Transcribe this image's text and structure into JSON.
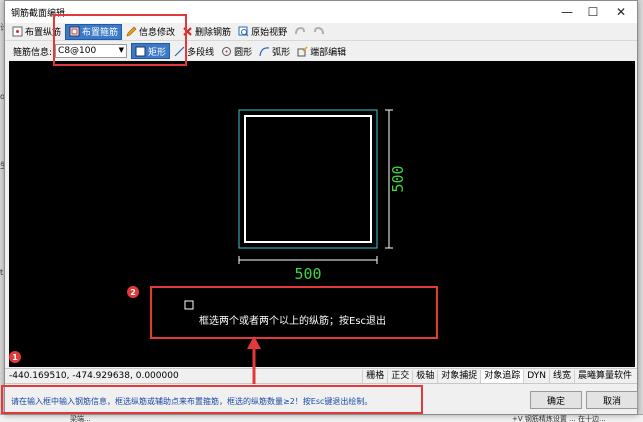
{
  "window": {
    "title": "钢筋截面编辑",
    "minimize": "—",
    "maximize": "☐",
    "close": "✕"
  },
  "toolbar1": {
    "items": [
      {
        "label": "布置纵筋",
        "icon": "longitudinal-rebar-icon"
      },
      {
        "label": "布置箍筋",
        "icon": "stirrup-icon",
        "active": true
      },
      {
        "label": "信息修改",
        "icon": "edit-info-icon"
      },
      {
        "label": "删除钢筋",
        "icon": "delete-icon"
      },
      {
        "label": "原始视野",
        "icon": "original-view-icon"
      }
    ]
  },
  "toolbar2": {
    "stirrup_label": "箍筋信息:",
    "stirrup_value": "C8@100",
    "shapes": [
      {
        "label": "矩形",
        "icon": "rectangle-icon",
        "active": true
      },
      {
        "label": "多段线",
        "icon": "polyline-icon"
      },
      {
        "label": "圆形",
        "icon": "circle-icon"
      },
      {
        "label": "弧形",
        "icon": "arc-icon"
      },
      {
        "label": "端部编辑",
        "icon": "end-edit-icon"
      }
    ]
  },
  "canvas": {
    "dim_width": "500",
    "dim_height": "500",
    "prompt": "框选两个或者两个以上的纵筋；按Esc退出"
  },
  "statusbar": {
    "coords": "-440.169510,  -474.929638,  0.000000",
    "toggles": [
      "栅格",
      "正交",
      "极轴",
      "对象捕捉",
      "对象追踪",
      "DYN",
      "线宽",
      "晨曦算量软件"
    ]
  },
  "cmdbar": {
    "text": "请在输入框中输入钢筋信息，框选纵筋或辅助点来布置箍筋，框选的纵筋数量≥2！按Esc键退出绘制。",
    "ok": "确定",
    "cancel": "取消"
  },
  "annotations": {
    "badge1": "1",
    "badge2": "2"
  },
  "background": {
    "left_chars": [
      "计",
      "o",
      "生",
      "t"
    ],
    "bottom_left": "梁端...",
    "bottom_right": "+V 钢筋精炼设置  ...  在十边..."
  },
  "colors": {
    "canvas_bg": "#000000",
    "stirrup": "#ffffff",
    "section_outline": "#3fc6d0",
    "dimension_text": "#3bd63b",
    "highlight": "#e23a3a",
    "active_button": "#3c79c6"
  }
}
